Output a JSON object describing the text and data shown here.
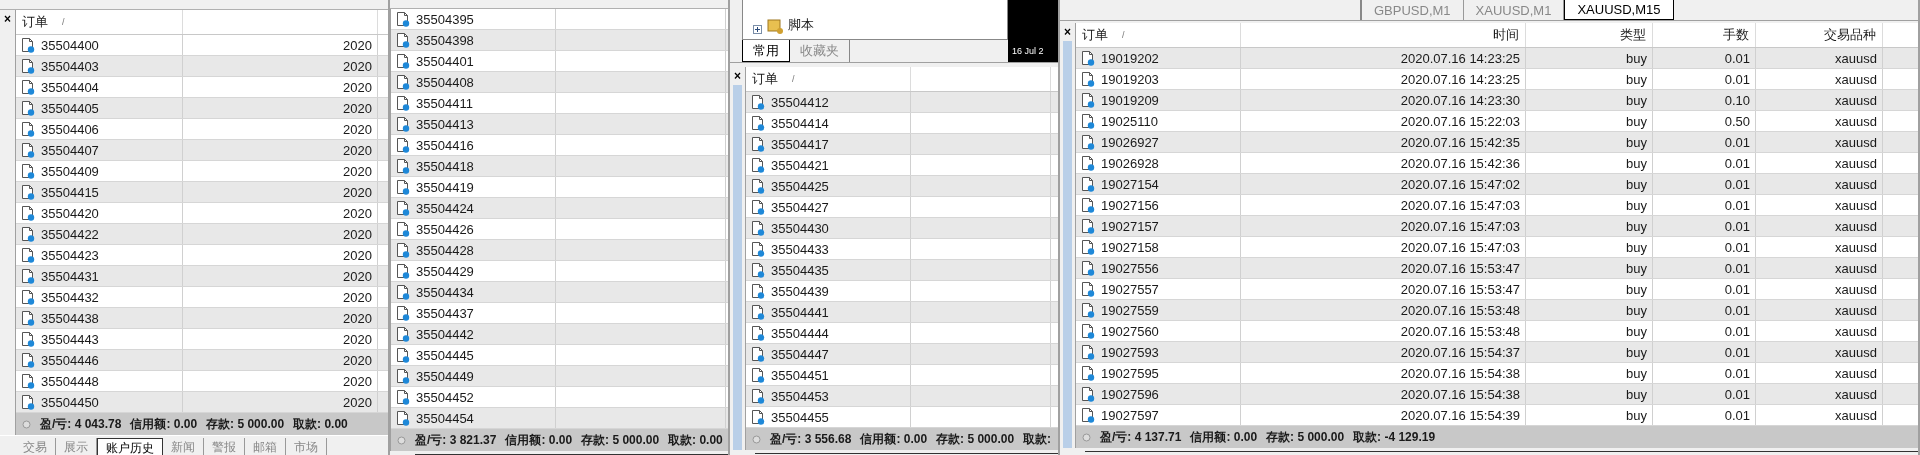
{
  "panels": [
    {
      "close": "×",
      "side_tinted": false,
      "first_row_shaded": false,
      "header": [
        {
          "label": "订单",
          "sort_mark": "/"
        }
      ],
      "rows": [
        [
          "35504400",
          "2020"
        ],
        [
          "35504403",
          "2020"
        ],
        [
          "35504404",
          "2020"
        ],
        [
          "35504405",
          "2020"
        ],
        [
          "35504406",
          "2020"
        ],
        [
          "35504407",
          "2020"
        ],
        [
          "35504409",
          "2020"
        ],
        [
          "35504415",
          "2020"
        ],
        [
          "35504420",
          "2020"
        ],
        [
          "35504422",
          "2020"
        ],
        [
          "35504423",
          "2020"
        ],
        [
          "35504431",
          "2020"
        ],
        [
          "35504432",
          "2020"
        ],
        [
          "35504438",
          "2020"
        ],
        [
          "35504443",
          "2020"
        ],
        [
          "35504446",
          "2020"
        ],
        [
          "35504448",
          "2020"
        ],
        [
          "35504450",
          "2020"
        ]
      ],
      "status": [
        "盈/亏: 4 043.78",
        "信用额: 0.00",
        "存款: 5 000.00",
        "取款: 0.00"
      ],
      "bottom_tabs": [
        {
          "label": "交易",
          "selected": false
        },
        {
          "label": "展示",
          "selected": false
        },
        {
          "label": "账户历史",
          "selected": true
        },
        {
          "label": "新闻",
          "selected": false
        },
        {
          "label": "警报",
          "selected": false
        },
        {
          "label": "邮箱",
          "selected": false
        },
        {
          "label": "市场",
          "selected": false
        }
      ]
    },
    {
      "first_row_shaded": false,
      "rows": [
        [
          "35504395"
        ],
        [
          "35504398"
        ],
        [
          "35504401"
        ],
        [
          "35504408"
        ],
        [
          "35504411"
        ],
        [
          "35504413"
        ],
        [
          "35504416"
        ],
        [
          "35504418"
        ],
        [
          "35504419"
        ],
        [
          "35504424"
        ],
        [
          "35504426"
        ],
        [
          "35504428"
        ],
        [
          "35504429"
        ],
        [
          "35504434"
        ],
        [
          "35504437"
        ],
        [
          "35504442"
        ],
        [
          "35504445"
        ],
        [
          "35504449"
        ],
        [
          "35504452"
        ],
        [
          "35504454"
        ]
      ],
      "status": [
        "盈/亏: 3 821.37",
        "信用额: 0.00",
        "存款: 5 000.00",
        "取款: 0.00"
      ]
    },
    {
      "navigator": {
        "tree_item": "脚本",
        "tabs": [
          {
            "label": "常用",
            "selected": true
          },
          {
            "label": "收藏夹",
            "selected": false
          }
        ],
        "chart_date": "16 Jul 2"
      },
      "close": "×",
      "side_tinted": true,
      "first_row_shaded": true,
      "header": [
        {
          "label": "订单",
          "sort_mark": "/"
        }
      ],
      "rows": [
        [
          "35504412"
        ],
        [
          "35504414"
        ],
        [
          "35504417"
        ],
        [
          "35504421"
        ],
        [
          "35504425"
        ],
        [
          "35504427"
        ],
        [
          "35504430"
        ],
        [
          "35504433"
        ],
        [
          "35504435"
        ],
        [
          "35504439"
        ],
        [
          "35504441"
        ],
        [
          "35504444"
        ],
        [
          "35504447"
        ],
        [
          "35504451"
        ],
        [
          "35504453"
        ],
        [
          "35504455"
        ]
      ],
      "status": [
        "盈/亏: 3 556.68",
        "信用额: 0.00",
        "存款: 5 000.00",
        "取款:"
      ]
    },
    {
      "chart_tabs": [
        {
          "label": "GBPUSD,M1",
          "selected": false
        },
        {
          "label": "XAUUSD,M1",
          "selected": false
        },
        {
          "label": "XAUUSD,M15",
          "selected": true
        }
      ],
      "close": "×",
      "side_tinted": true,
      "first_row_shaded": true,
      "header": [
        {
          "label": "订单",
          "sort_mark": "/"
        },
        {
          "label": "时间"
        },
        {
          "label": "类型"
        },
        {
          "label": "手数"
        },
        {
          "label": "交易品种"
        }
      ],
      "rows": [
        [
          "19019202",
          "2020.07.16 14:23:25",
          "buy",
          "0.01",
          "xauusd"
        ],
        [
          "19019203",
          "2020.07.16 14:23:25",
          "buy",
          "0.01",
          "xauusd"
        ],
        [
          "19019209",
          "2020.07.16 14:23:30",
          "buy",
          "0.10",
          "xauusd"
        ],
        [
          "19025110",
          "2020.07.16 15:22:03",
          "buy",
          "0.50",
          "xauusd"
        ],
        [
          "19026927",
          "2020.07.16 15:42:35",
          "buy",
          "0.01",
          "xauusd"
        ],
        [
          "19026928",
          "2020.07.16 15:42:36",
          "buy",
          "0.01",
          "xauusd"
        ],
        [
          "19027154",
          "2020.07.16 15:47:02",
          "buy",
          "0.01",
          "xauusd"
        ],
        [
          "19027156",
          "2020.07.16 15:47:03",
          "buy",
          "0.01",
          "xauusd"
        ],
        [
          "19027157",
          "2020.07.16 15:47:03",
          "buy",
          "0.01",
          "xauusd"
        ],
        [
          "19027158",
          "2020.07.16 15:47:03",
          "buy",
          "0.01",
          "xauusd"
        ],
        [
          "19027556",
          "2020.07.16 15:53:47",
          "buy",
          "0.01",
          "xauusd"
        ],
        [
          "19027557",
          "2020.07.16 15:53:47",
          "buy",
          "0.01",
          "xauusd"
        ],
        [
          "19027559",
          "2020.07.16 15:53:48",
          "buy",
          "0.01",
          "xauusd"
        ],
        [
          "19027560",
          "2020.07.16 15:53:48",
          "buy",
          "0.01",
          "xauusd"
        ],
        [
          "19027593",
          "2020.07.16 15:54:37",
          "buy",
          "0.01",
          "xauusd"
        ],
        [
          "19027595",
          "2020.07.16 15:54:38",
          "buy",
          "0.01",
          "xauusd"
        ],
        [
          "19027596",
          "2020.07.16 15:54:38",
          "buy",
          "0.01",
          "xauusd"
        ],
        [
          "19027597",
          "2020.07.16 15:54:39",
          "buy",
          "0.01",
          "xauusd"
        ]
      ],
      "status": [
        "盈/亏: 4 137.71",
        "信用额: 0.00",
        "存款: 5 000.00",
        "取款: -4 129.19"
      ]
    }
  ]
}
